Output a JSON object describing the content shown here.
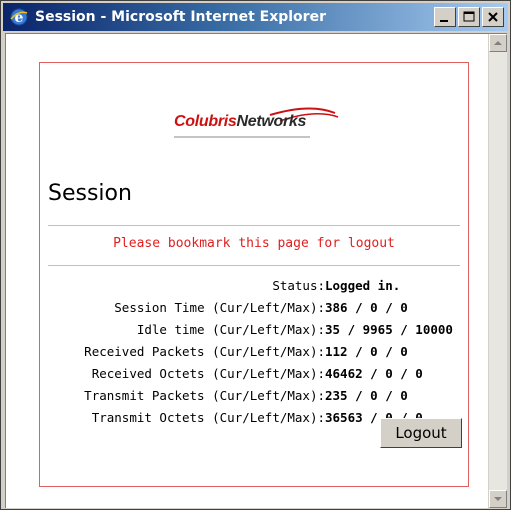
{
  "window": {
    "title": "Session - Microsoft Internet Explorer"
  },
  "logo": {
    "part1": "Colubris",
    "part2": "Networks"
  },
  "page": {
    "heading": "Session",
    "bookmark_note": "Please bookmark this page for logout"
  },
  "stats": [
    {
      "label": "Status:",
      "value": "Logged in."
    },
    {
      "label": "Session Time (Cur/Left/Max):",
      "value": "386 / 0 / 0"
    },
    {
      "label": "Idle time (Cur/Left/Max):",
      "value": "35 / 9965 / 10000"
    },
    {
      "label": "Received Packets (Cur/Left/Max):",
      "value": "112 / 0 / 0"
    },
    {
      "label": "Received Octets (Cur/Left/Max):",
      "value": "46462 / 0 / 0"
    },
    {
      "label": "Transmit Packets (Cur/Left/Max):",
      "value": "235 / 0 / 0"
    },
    {
      "label": "Transmit Octets (Cur/Left/Max):",
      "value": "36563 / 0 / 0"
    }
  ],
  "buttons": {
    "logout": "Logout"
  },
  "colors": {
    "panel_border": "#e06060",
    "bookmark_text": "#e02020",
    "title_bar": "#0a246a"
  }
}
